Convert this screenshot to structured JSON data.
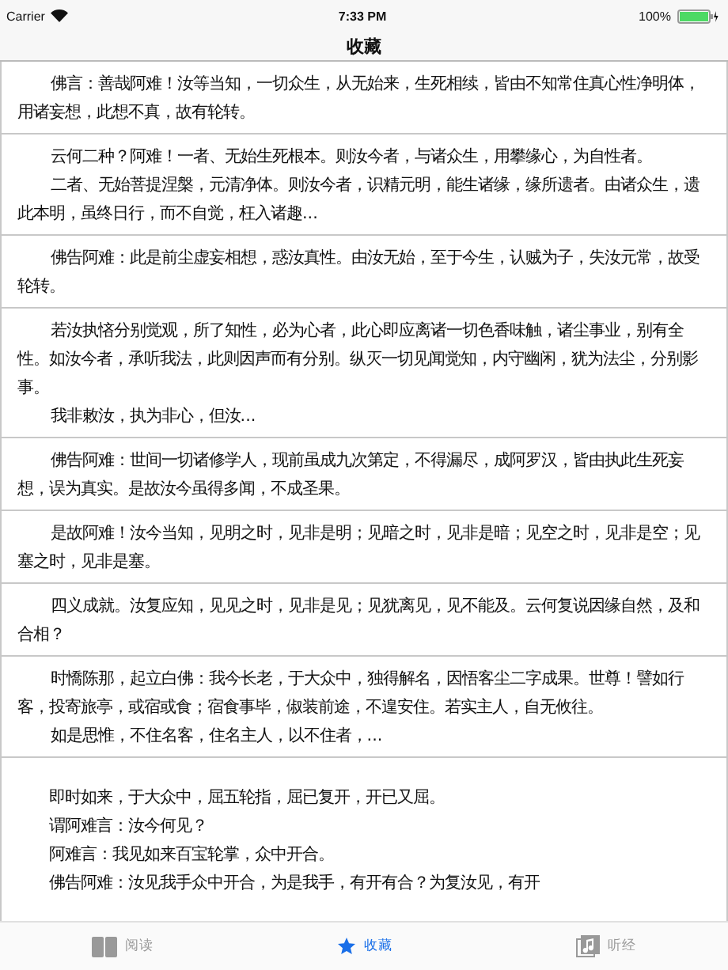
{
  "status_bar": {
    "carrier": "Carrier",
    "time": "7:33 PM",
    "battery": "100%"
  },
  "nav": {
    "title": "收藏"
  },
  "cards": [
    {
      "kind": "prose",
      "paragraphs": [
        "佛言：善哉阿难！汝等当知，一切众生，从无始来，生死相续，皆由不知常住真心性净明体，用诸妄想，此想不真，故有轮转。"
      ]
    },
    {
      "kind": "prose",
      "paragraphs": [
        "云何二种？阿难！一者、无始生死根本。则汝今者，与诸众生，用攀缘心，为自性者。",
        "二者、无始菩提涅槃，元清净体。则汝今者，识精元明，能生诸缘，缘所遗者。由诸众生，遗此本明，虽终日行，而不自觉，枉入诸趣..."
      ]
    },
    {
      "kind": "prose",
      "paragraphs": [
        "佛告阿难：此是前尘虚妄相想，惑汝真性。由汝无始，至于今生，认贼为子，失汝元常，故受轮转。"
      ]
    },
    {
      "kind": "prose",
      "paragraphs": [
        "若汝执悋分别觉观，所了知性，必为心者，此心即应离诸一切色香味触，诸尘事业，别有全性。如汝今者，承听我法，此则因声而有分别。纵灭一切见闻觉知，内守幽闲，犹为法尘，分别影事。",
        "我非敕汝，执为非心，但汝..."
      ]
    },
    {
      "kind": "prose",
      "paragraphs": [
        "佛告阿难：世间一切诸修学人，现前虽成九次第定，不得漏尽，成阿罗汉，皆由执此生死妄想，误为真实。是故汝今虽得多闻，不成圣果。"
      ]
    },
    {
      "kind": "prose",
      "paragraphs": [
        "是故阿难！汝今当知，见明之时，见非是明；见暗之时，见非是暗；见空之时，见非是空；见塞之时，见非是塞。"
      ]
    },
    {
      "kind": "prose",
      "paragraphs": [
        "四义成就。汝复应知，见见之时，见非是见；见犹离见，见不能及。云何复说因缘自然，及和合相？"
      ]
    },
    {
      "kind": "prose",
      "paragraphs": [
        "时憍陈那，起立白佛：我今长老，于大众中，独得解名，因悟客尘二字成果。世尊！譬如行客，投寄旅亭，或宿或食；宿食事毕，俶装前途，不遑安住。若实主人，自无攸往。",
        "如是思惟，不住名客，住名主人，以不住者，..."
      ]
    },
    {
      "kind": "lines",
      "paragraphs": [
        "即时如来，于大众中，屈五轮指，屈已复开，开已又屈。",
        "谓阿难言：汝今何见？",
        "阿难言：我见如来百宝轮掌，众中开合。",
        "佛告阿难：汝见我手众中开合，为是我手，有开有合？为复汝见，有开"
      ]
    }
  ],
  "tabs": [
    {
      "label": "阅读",
      "kind": "read",
      "selected": false
    },
    {
      "label": "收藏",
      "kind": "favorites",
      "selected": true
    },
    {
      "label": "听经",
      "kind": "listen",
      "selected": false
    }
  ]
}
